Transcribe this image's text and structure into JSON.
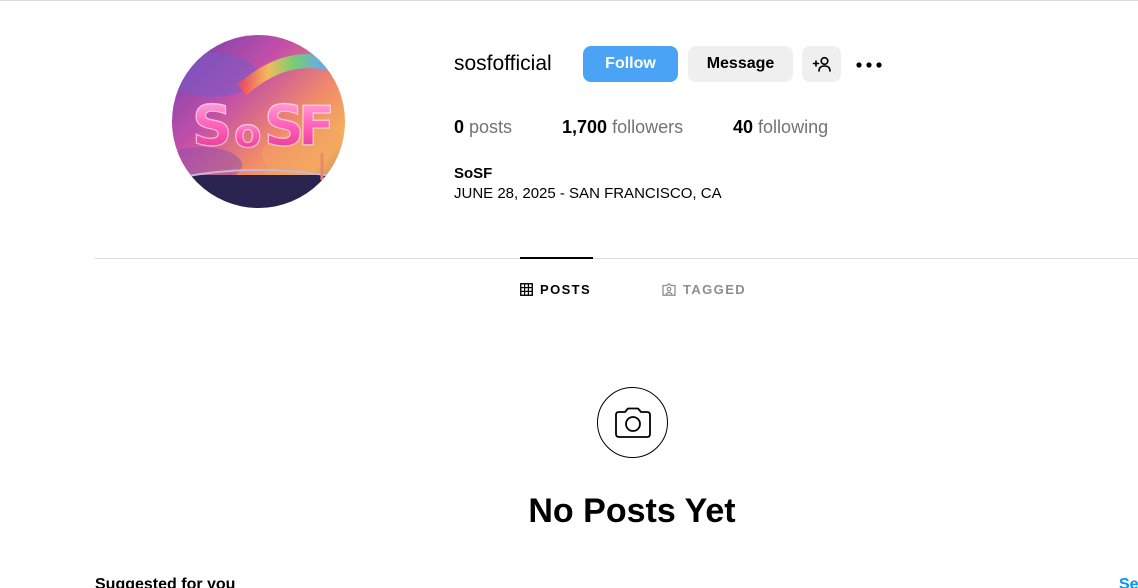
{
  "profile": {
    "username": "sosfofficial",
    "avatar_logo_text": "SoSF",
    "follow_label": "Follow",
    "message_label": "Message",
    "suggest_icon": "add-person-icon",
    "more_icon": "more-options-icon",
    "stats": {
      "posts_count": "0",
      "posts_label": "posts",
      "followers_count": "1,700",
      "followers_label": "followers",
      "following_count": "40",
      "following_label": "following"
    },
    "bio": {
      "name": "SoSF",
      "text": "JUNE 28, 2025 - SAN FRANCISCO, CA"
    }
  },
  "tabs": [
    {
      "label": "POSTS",
      "icon": "grid-icon",
      "active": true
    },
    {
      "label": "TAGGED",
      "icon": "tagged-icon",
      "active": false
    }
  ],
  "empty_state": {
    "icon": "camera-icon",
    "title": "No Posts Yet"
  },
  "suggested": {
    "title": "Suggested for you",
    "see_all": "See all"
  },
  "colors": {
    "follow_button": "#4aa3f5",
    "secondary_button": "#efefef",
    "link": "#0095f6",
    "muted_text": "#737373",
    "divider": "#dbdbdb"
  }
}
